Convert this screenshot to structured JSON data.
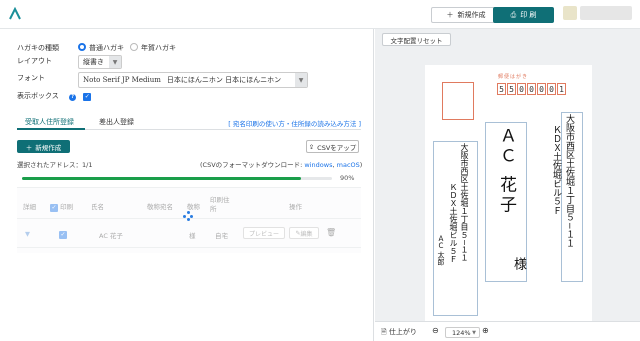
{
  "header": {
    "new_label": "新規作成",
    "print_label": "印 刷",
    "accent": "#0f6f76"
  },
  "settings": {
    "hagaki_type_label": "ハガキの種類",
    "hagaki_options": [
      "普通ハガキ",
      "年賀ハガキ"
    ],
    "layout_label": "レイアウト",
    "layout_value": "縦書き",
    "font_label": "フォント",
    "font_value": "Noto Serif JP Medium",
    "font_sample": "日本にほんニホン 日本にほんニホン",
    "display_box_label": "表示ボックス"
  },
  "tabs": {
    "items": [
      "受取人住所登録",
      "差出人登録"
    ],
    "help_link": "[ 宛名印刷の使い方・住所録の読み込み方法 ]"
  },
  "actions": {
    "create_label": "新規作成",
    "csv_label": "CSVをアップ",
    "selected": "選択されたアドレス：1/1",
    "csv_download_prefix": "(CSVのフォーマットダウンロード:",
    "csv_windows": "windows",
    "csv_mac": "macOS",
    "csv_suffix": ")",
    "progress_percent": 90,
    "progress_text": "90%"
  },
  "table": {
    "headers": [
      "詳細",
      "印刷",
      "氏名",
      "敬称宛名",
      "敬称",
      "印刷住所",
      "操作"
    ],
    "row": {
      "name": "AC 花子",
      "honorific": "様",
      "address_type": "自宅",
      "preview": "プレビュー",
      "edit": "編集"
    }
  },
  "preview": {
    "reset_label": "文字配置リセット",
    "stamp_text": "郵便はがき",
    "postal": [
      "5",
      "5",
      "0",
      "0",
      "0",
      "0",
      "1"
    ],
    "recipient_address": "大阪市西区土佐堀１丁目５−１１",
    "recipient_building": "ＫＤＸ土佐堀ビル５Ｆ",
    "recipient_name": "ＡＣ 花子",
    "recipient_honorific": "様",
    "sender_address": "大阪市西区土佐堀１丁目５−１１",
    "sender_building": "ＫＤＸ土佐堀ビル５Ｆ",
    "sender_name": "ＡＣ 太郎",
    "sender_postal": [
      "5",
      "5",
      "0",
      "0",
      "0",
      "0",
      "1"
    ],
    "finish_label": "仕上がり",
    "zoom": "124%"
  }
}
